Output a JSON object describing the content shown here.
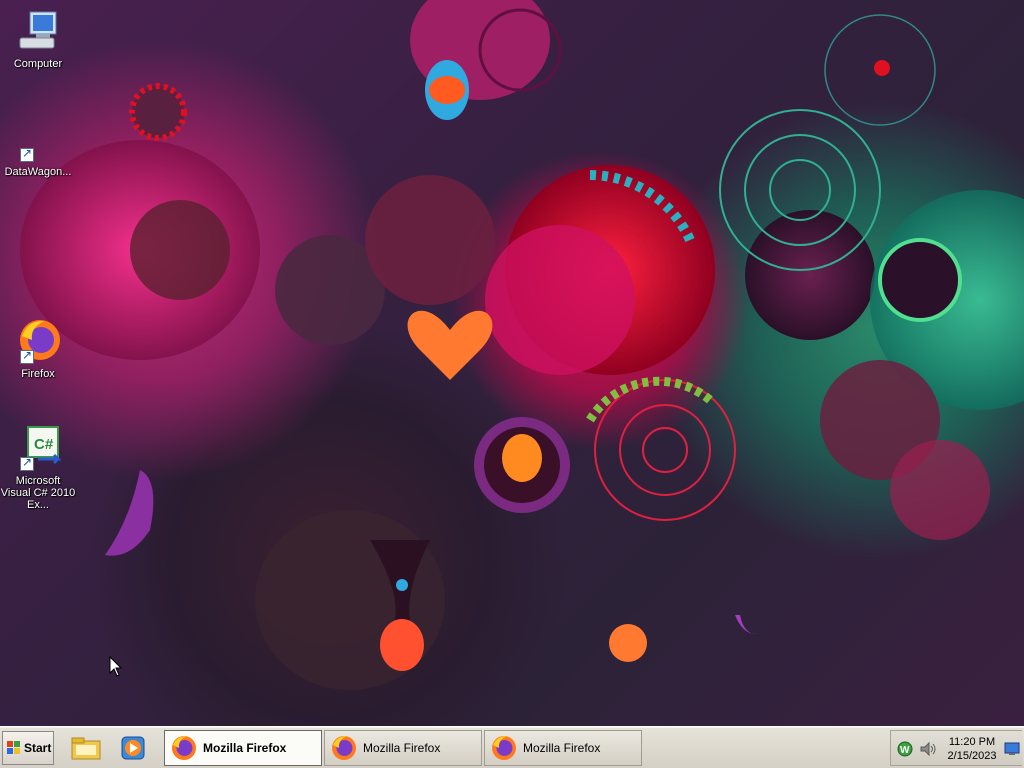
{
  "desktop": {
    "icons": [
      {
        "label": "Computer",
        "icon": "computer-icon"
      },
      {
        "label": "DataWagon...",
        "icon": "shortcut-icon"
      },
      {
        "label": "Firefox",
        "icon": "firefox-icon"
      },
      {
        "label": "Microsoft Visual C# 2010 Ex...",
        "icon": "visual-csharp-icon"
      }
    ]
  },
  "taskbar": {
    "start_label": "Start",
    "quick_launch": [
      {
        "icon": "explorer-folder-icon"
      },
      {
        "icon": "media-player-icon"
      }
    ],
    "tasks": [
      {
        "label": "Mozilla Firefox",
        "active": true
      },
      {
        "label": "Mozilla Firefox",
        "active": false
      },
      {
        "label": "Mozilla Firefox",
        "active": false
      }
    ],
    "tray": {
      "icons": [
        "network-w-icon",
        "volume-icon",
        "show-desktop-icon"
      ],
      "time": "11:20 PM",
      "date": "2/15/2023"
    }
  },
  "colors": {
    "taskbar_bg": "#d4d0c6",
    "wallpaper_magenta": "#c0307a",
    "wallpaper_red": "#c4104a",
    "wallpaper_teal": "#2a8a6a"
  }
}
